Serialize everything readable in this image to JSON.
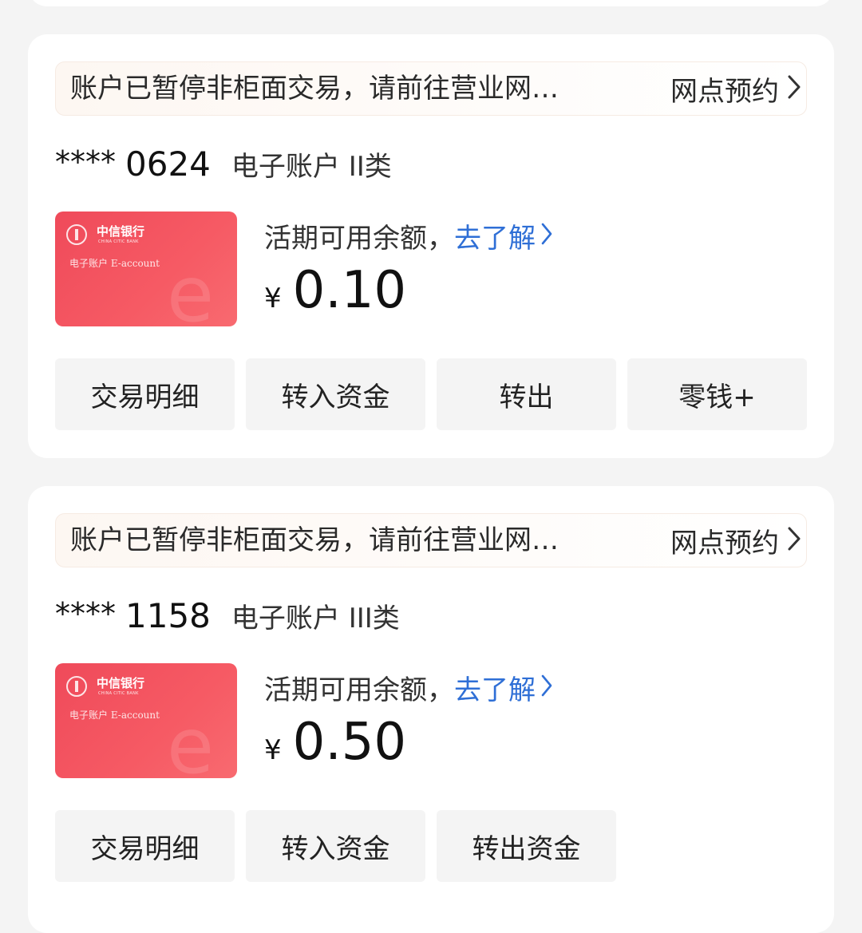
{
  "accounts": [
    {
      "notice": {
        "text": "账户已暂停非柜面交易，请前往营业网…",
        "link_label": "网点预约"
      },
      "mask": "****",
      "last4": "0624",
      "type": "电子账户 II类",
      "card": {
        "bank_name": "中信银行",
        "bank_name_en": "CHINA CITIC BANK",
        "label": "电子账户 E-account",
        "watermark": "e"
      },
      "balance_label": "活期可用余额，",
      "learn_more": "去了解",
      "currency": "¥",
      "balance": "0.10",
      "actions": [
        "交易明细",
        "转入资金",
        "转出",
        "零钱+"
      ]
    },
    {
      "notice": {
        "text": "账户已暂停非柜面交易，请前往营业网…",
        "link_label": "网点预约"
      },
      "mask": "****",
      "last4": "1158",
      "type": "电子账户 III类",
      "card": {
        "bank_name": "中信银行",
        "bank_name_en": "CHINA CITIC BANK",
        "label": "电子账户 E-account",
        "watermark": "e"
      },
      "balance_label": "活期可用余额，",
      "learn_more": "去了解",
      "currency": "¥",
      "balance": "0.50",
      "actions": [
        "交易明细",
        "转入资金",
        "转出资金"
      ]
    }
  ],
  "colors": {
    "accent_link": "#2f6fd6",
    "card_red": "#f0505d"
  },
  "icons": {
    "notice_link": "chevron-right-icon",
    "learn_more": "chevron-right-icon"
  }
}
